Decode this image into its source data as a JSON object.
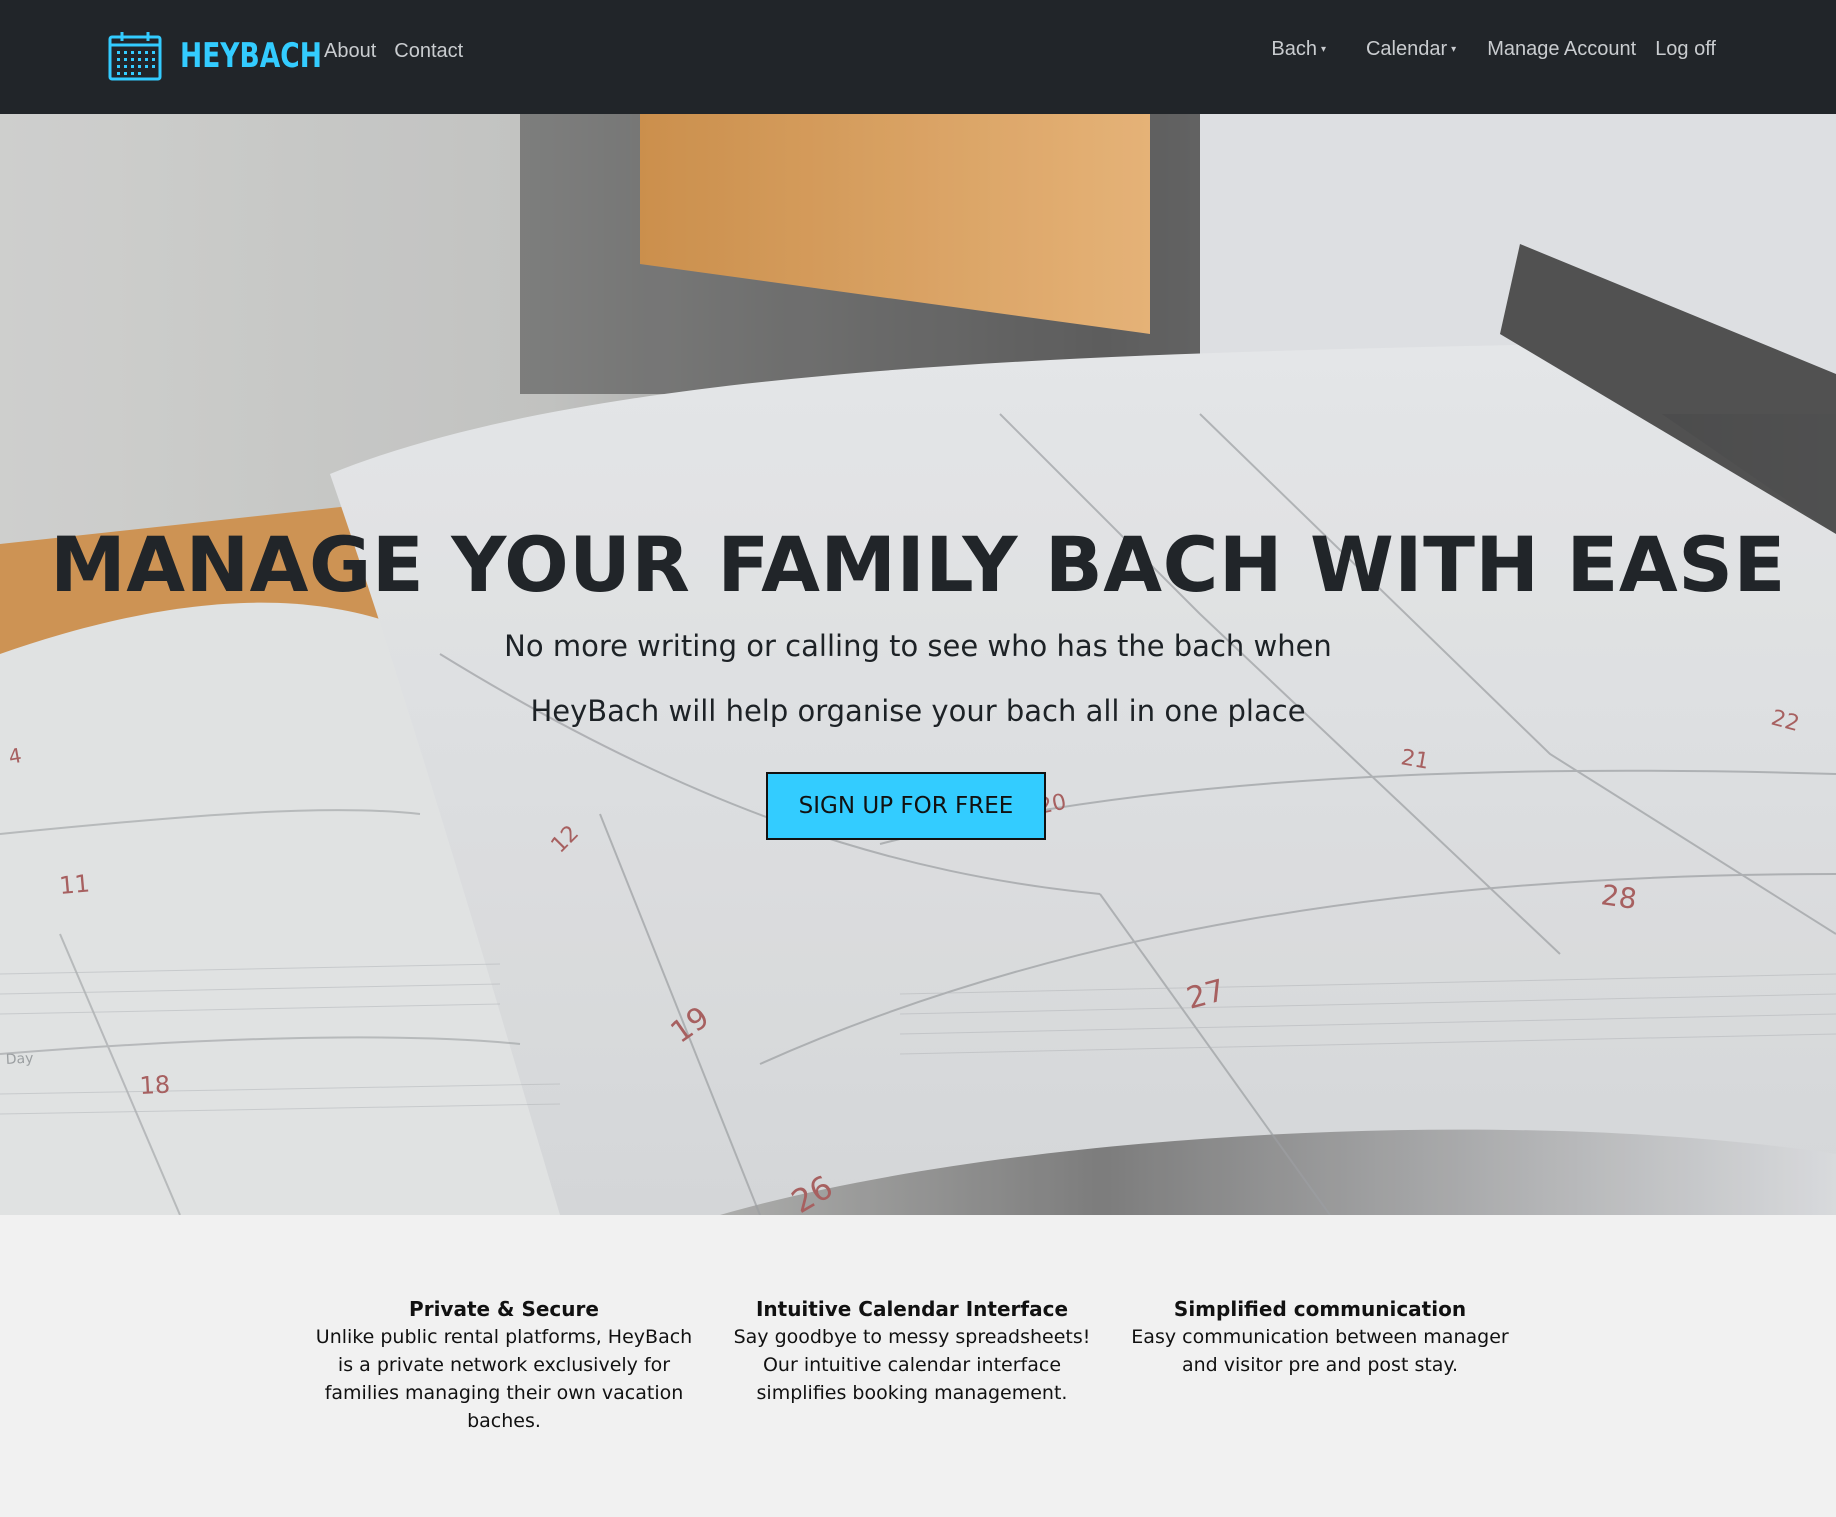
{
  "brand": {
    "name": "HEYBACH",
    "icon": "calendar-icon",
    "color": "#33ccff"
  },
  "nav": {
    "about": "About",
    "contact": "Contact",
    "bach": "Bach",
    "calendar": "Calendar",
    "manage_account": "Manage Account",
    "log_off": "Log off",
    "caret": "▾"
  },
  "hero": {
    "title": "MANAGE YOUR FAMILY BACH WITH EASE",
    "subtitle_1": "No more writing or calling to see who has the bach when",
    "subtitle_2": "HeyBach will help organise your bach all in one place",
    "cta": "SIGN UP FOR FREE",
    "cta_color": "#33ccff"
  },
  "features": [
    {
      "title": "Private & Secure",
      "text": "Unlike public rental platforms, HeyBach is a private network exclusively for families managing their own vacation baches."
    },
    {
      "title": "Intuitive Calendar Interface",
      "text": "Say goodbye to messy spreadsheets! Our intuitive calendar interface simplifies booking management."
    },
    {
      "title": "Simplified communication",
      "text": "Easy communication between manager and visitor pre and post stay."
    }
  ],
  "background_dates": [
    "4",
    "11",
    "18",
    "19",
    "12",
    "20",
    "21",
    "22",
    "26",
    "27",
    "28",
    "Day"
  ]
}
